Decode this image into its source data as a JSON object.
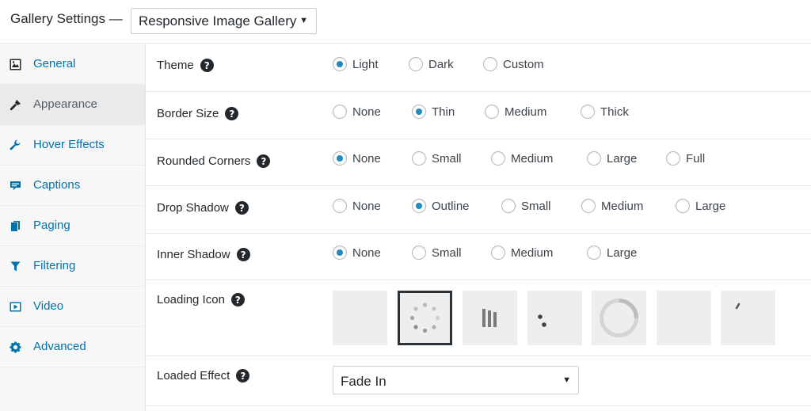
{
  "header": {
    "title": "Gallery Settings —",
    "gallery_select": {
      "value": "Responsive Image Gallery"
    }
  },
  "sidebar": {
    "items": [
      {
        "label": "General",
        "icon": "image-icon"
      },
      {
        "label": "Appearance",
        "icon": "brush-icon",
        "active": true
      },
      {
        "label": "Hover Effects",
        "icon": "wrench-icon"
      },
      {
        "label": "Captions",
        "icon": "comment-icon"
      },
      {
        "label": "Paging",
        "icon": "pages-icon"
      },
      {
        "label": "Filtering",
        "icon": "filter-icon"
      },
      {
        "label": "Video",
        "icon": "video-icon"
      },
      {
        "label": "Advanced",
        "icon": "gear-icon"
      }
    ]
  },
  "settings": {
    "theme": {
      "label": "Theme",
      "options": [
        "Light",
        "Dark",
        "Custom"
      ],
      "selected": "Light"
    },
    "border_size": {
      "label": "Border Size",
      "options": [
        "None",
        "Thin",
        "Medium",
        "Thick"
      ],
      "selected": "Thin"
    },
    "rounded_corners": {
      "label": "Rounded Corners",
      "options": [
        "None",
        "Small",
        "Medium",
        "Large",
        "Full"
      ],
      "selected": "None"
    },
    "drop_shadow": {
      "label": "Drop Shadow",
      "options": [
        "None",
        "Outline",
        "Small",
        "Medium",
        "Large"
      ],
      "selected": "Outline"
    },
    "inner_shadow": {
      "label": "Inner Shadow",
      "options": [
        "None",
        "Small",
        "Medium",
        "Large"
      ],
      "selected": "None"
    },
    "loading_icon": {
      "label": "Loading Icon",
      "icons": [
        "none",
        "dots-circle",
        "bars",
        "dots-pair",
        "ring",
        "blank",
        "partial-ring"
      ],
      "selected": "dots-circle"
    },
    "loaded_effect": {
      "label": "Loaded Effect",
      "value": "Fade In"
    }
  },
  "colors": {
    "accent": "#1e8cbe",
    "link": "#0073aa",
    "text": "#23282d"
  },
  "icons": {
    "help": "?",
    "dropdown": "▼"
  }
}
